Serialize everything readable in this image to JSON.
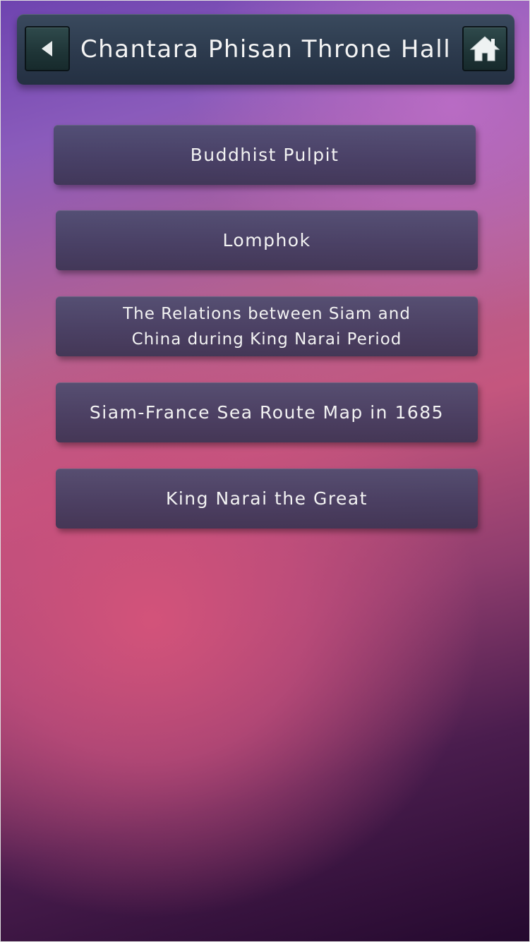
{
  "header": {
    "title": "Chantara Phisan Throne Hall",
    "back_icon": "back-arrow-icon",
    "home_icon": "home-icon"
  },
  "menu": {
    "items": [
      {
        "label": "Buddhist Pulpit"
      },
      {
        "label": "Lomphok"
      },
      {
        "label": "The Relations between Siam and China during King Narai Period"
      },
      {
        "label": "Siam-France Sea Route Map in 1685"
      },
      {
        "label": "King Narai the Great"
      }
    ]
  },
  "colors": {
    "header_bg": "#2c3a4d",
    "button_bg": "#4a4670",
    "text": "#f2f2f2",
    "accent_pink": "#d6547a",
    "accent_purple": "#6e44b0"
  }
}
